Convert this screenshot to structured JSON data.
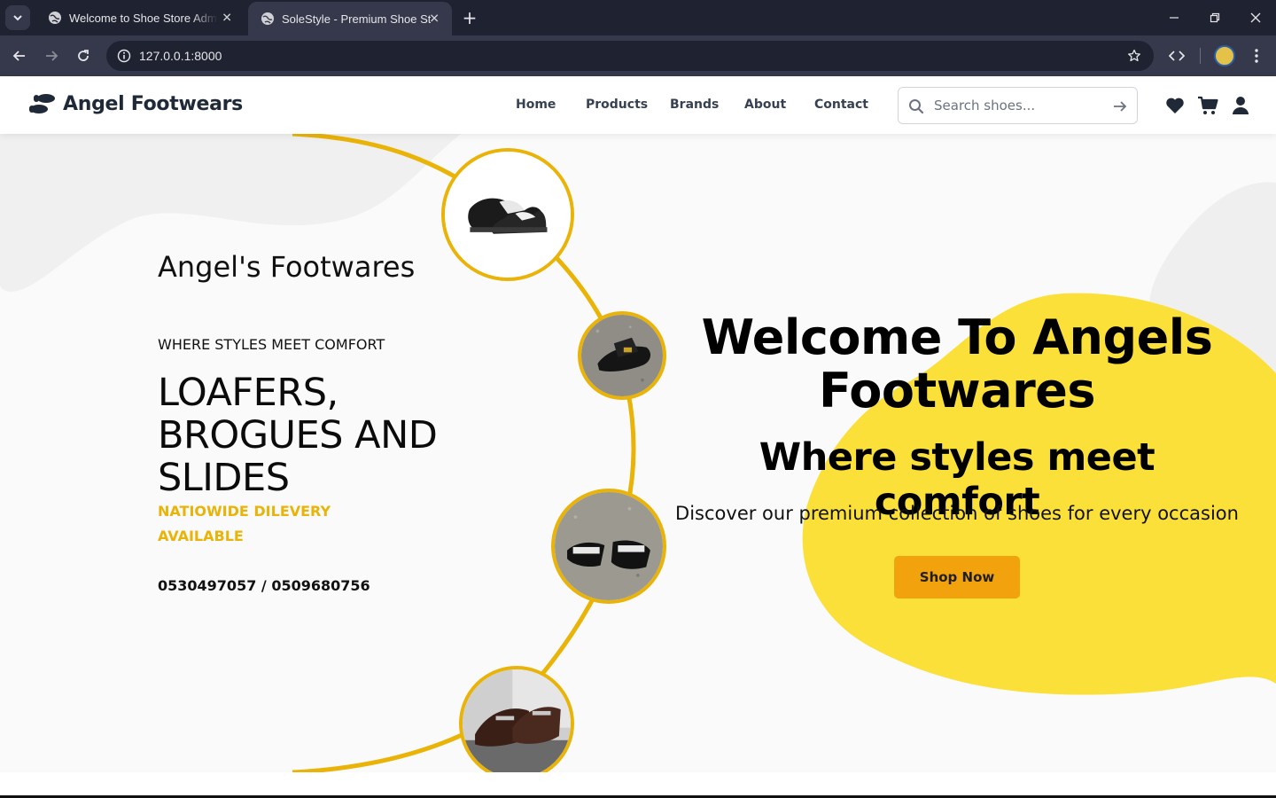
{
  "browser": {
    "tabs": [
      {
        "title": "Welcome to Shoe Store Admin"
      },
      {
        "title": "SoleStyle - Premium Shoe Store"
      }
    ],
    "url": "127.0.0.1:8000"
  },
  "header": {
    "brand": "Angel Footwears",
    "nav": [
      "Home",
      "Products",
      "Brands",
      "About",
      "Contact"
    ],
    "search_placeholder": "Search shoes..."
  },
  "hero": {
    "store_title": "Angel's Footwares",
    "tagline": "WHERE STYLES MEET COMFORT",
    "styles_headline": "LOAFERS, BROGUES AND SLIDES",
    "delivery": "NATIOWIDE DILEVERY AVAILABLE",
    "phones": "0530497057 / 0509680756",
    "welcome": "Welcome To Angels Footwares",
    "subheading": "Where styles meet comfort",
    "description": "Discover our premium collection of shoes for every occasion",
    "cta": "Shop Now"
  },
  "colors": {
    "accent_yellow": "#eab308",
    "blob_yellow": "#fbe03a",
    "cta_orange": "#f2a20c",
    "chrome_dark": "#1f2230",
    "chrome_mid": "#35394b"
  },
  "icons": {
    "brand": "shoe-prints-icon",
    "search": "search-icon",
    "search_submit": "arrow-right-icon",
    "wishlist": "heart-icon",
    "cart": "cart-icon",
    "account": "user-icon"
  }
}
